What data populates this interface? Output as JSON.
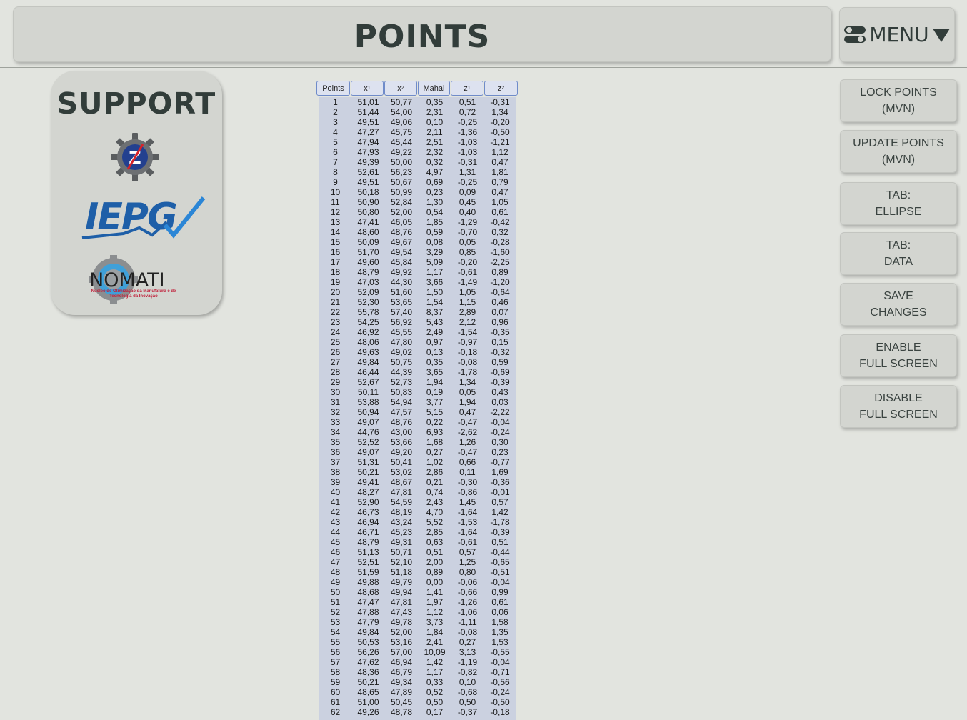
{
  "header": {
    "title": "POINTS",
    "menu_label": "MENU"
  },
  "support": {
    "title": "SUPPORT",
    "logos": [
      {
        "name": "gear-z-logo",
        "text": "Z"
      },
      {
        "name": "iepg-logo",
        "text": "IEPG"
      },
      {
        "name": "nomati-logo",
        "text": "NOMATI",
        "subtext": "Núcleo de Otimização da Manufatura e de Tecnologia da Inovação"
      }
    ]
  },
  "table": {
    "columns": [
      {
        "label": "Points",
        "sub": ""
      },
      {
        "label": "x",
        "sub": "1"
      },
      {
        "label": "x",
        "sub": "2"
      },
      {
        "label": "Mahal",
        "sub": ""
      },
      {
        "label": "z",
        "sub": "1"
      },
      {
        "label": "z",
        "sub": "2"
      }
    ],
    "rows": [
      [
        "1",
        "51,01",
        "50,77",
        "0,35",
        "0,51",
        "-0,31"
      ],
      [
        "2",
        "51,44",
        "54,00",
        "2,31",
        "0,72",
        "1,34"
      ],
      [
        "3",
        "49,51",
        "49,06",
        "0,10",
        "-0,25",
        "-0,20"
      ],
      [
        "4",
        "47,27",
        "45,75",
        "2,11",
        "-1,36",
        "-0,50"
      ],
      [
        "5",
        "47,94",
        "45,44",
        "2,51",
        "-1,03",
        "-1,21"
      ],
      [
        "6",
        "47,93",
        "49,22",
        "2,32",
        "-1,03",
        "1,12"
      ],
      [
        "7",
        "49,39",
        "50,00",
        "0,32",
        "-0,31",
        "0,47"
      ],
      [
        "8",
        "52,61",
        "56,23",
        "4,97",
        "1,31",
        "1,81"
      ],
      [
        "9",
        "49,51",
        "50,67",
        "0,69",
        "-0,25",
        "0,79"
      ],
      [
        "10",
        "50,18",
        "50,99",
        "0,23",
        "0,09",
        "0,47"
      ],
      [
        "11",
        "50,90",
        "52,84",
        "1,30",
        "0,45",
        "1,05"
      ],
      [
        "12",
        "50,80",
        "52,00",
        "0,54",
        "0,40",
        "0,61"
      ],
      [
        "13",
        "47,41",
        "46,05",
        "1,85",
        "-1,29",
        "-0,42"
      ],
      [
        "14",
        "48,60",
        "48,76",
        "0,59",
        "-0,70",
        "0,32"
      ],
      [
        "15",
        "50,09",
        "49,67",
        "0,08",
        "0,05",
        "-0,28"
      ],
      [
        "16",
        "51,70",
        "49,54",
        "3,29",
        "0,85",
        "-1,60"
      ],
      [
        "17",
        "49,60",
        "45,84",
        "5,09",
        "-0,20",
        "-2,25"
      ],
      [
        "18",
        "48,79",
        "49,92",
        "1,17",
        "-0,61",
        "0,89"
      ],
      [
        "19",
        "47,03",
        "44,30",
        "3,66",
        "-1,49",
        "-1,20"
      ],
      [
        "20",
        "52,09",
        "51,60",
        "1,50",
        "1,05",
        "-0,64"
      ],
      [
        "21",
        "52,30",
        "53,65",
        "1,54",
        "1,15",
        "0,46"
      ],
      [
        "22",
        "55,78",
        "57,40",
        "8,37",
        "2,89",
        "0,07"
      ],
      [
        "23",
        "54,25",
        "56,92",
        "5,43",
        "2,12",
        "0,96"
      ],
      [
        "24",
        "46,92",
        "45,55",
        "2,49",
        "-1,54",
        "-0,35"
      ],
      [
        "25",
        "48,06",
        "47,80",
        "0,97",
        "-0,97",
        "0,15"
      ],
      [
        "26",
        "49,63",
        "49,02",
        "0,13",
        "-0,18",
        "-0,32"
      ],
      [
        "27",
        "49,84",
        "50,75",
        "0,35",
        "-0,08",
        "0,59"
      ],
      [
        "28",
        "46,44",
        "44,39",
        "3,65",
        "-1,78",
        "-0,69"
      ],
      [
        "29",
        "52,67",
        "52,73",
        "1,94",
        "1,34",
        "-0,39"
      ],
      [
        "30",
        "50,11",
        "50,83",
        "0,19",
        "0,05",
        "0,43"
      ],
      [
        "31",
        "53,88",
        "54,94",
        "3,77",
        "1,94",
        "0,03"
      ],
      [
        "32",
        "50,94",
        "47,57",
        "5,15",
        "0,47",
        "-2,22"
      ],
      [
        "33",
        "49,07",
        "48,76",
        "0,22",
        "-0,47",
        "-0,04"
      ],
      [
        "34",
        "44,76",
        "43,00",
        "6,93",
        "-2,62",
        "-0,24"
      ],
      [
        "35",
        "52,52",
        "53,66",
        "1,68",
        "1,26",
        "0,30"
      ],
      [
        "36",
        "49,07",
        "49,20",
        "0,27",
        "-0,47",
        "0,23"
      ],
      [
        "37",
        "51,31",
        "50,41",
        "1,02",
        "0,66",
        "-0,77"
      ],
      [
        "38",
        "50,21",
        "53,02",
        "2,86",
        "0,11",
        "1,69"
      ],
      [
        "39",
        "49,41",
        "48,67",
        "0,21",
        "-0,30",
        "-0,36"
      ],
      [
        "40",
        "48,27",
        "47,81",
        "0,74",
        "-0,86",
        "-0,01"
      ],
      [
        "41",
        "52,90",
        "54,59",
        "2,43",
        "1,45",
        "0,57"
      ],
      [
        "42",
        "46,73",
        "48,19",
        "4,70",
        "-1,64",
        "1,42"
      ],
      [
        "43",
        "46,94",
        "43,24",
        "5,52",
        "-1,53",
        "-1,78"
      ],
      [
        "44",
        "46,71",
        "45,23",
        "2,85",
        "-1,64",
        "-0,39"
      ],
      [
        "45",
        "48,79",
        "49,31",
        "0,63",
        "-0,61",
        "0,51"
      ],
      [
        "46",
        "51,13",
        "50,71",
        "0,51",
        "0,57",
        "-0,44"
      ],
      [
        "47",
        "52,51",
        "52,10",
        "2,00",
        "1,25",
        "-0,65"
      ],
      [
        "48",
        "51,59",
        "51,18",
        "0,89",
        "0,80",
        "-0,51"
      ],
      [
        "49",
        "49,88",
        "49,79",
        "0,00",
        "-0,06",
        "-0,04"
      ],
      [
        "50",
        "48,68",
        "49,94",
        "1,41",
        "-0,66",
        "0,99"
      ],
      [
        "51",
        "47,47",
        "47,81",
        "1,97",
        "-1,26",
        "0,61"
      ],
      [
        "52",
        "47,88",
        "47,43",
        "1,12",
        "-1,06",
        "0,06"
      ],
      [
        "53",
        "47,79",
        "49,78",
        "3,73",
        "-1,11",
        "1,58"
      ],
      [
        "54",
        "49,84",
        "52,00",
        "1,84",
        "-0,08",
        "1,35"
      ],
      [
        "55",
        "50,53",
        "53,16",
        "2,41",
        "0,27",
        "1,53"
      ],
      [
        "56",
        "56,26",
        "57,00",
        "10,09",
        "3,13",
        "-0,55"
      ],
      [
        "57",
        "47,62",
        "46,94",
        "1,42",
        "-1,19",
        "-0,04"
      ],
      [
        "58",
        "48,36",
        "46,79",
        "1,17",
        "-0,82",
        "-0,71"
      ],
      [
        "59",
        "50,21",
        "49,34",
        "0,33",
        "0,10",
        "-0,56"
      ],
      [
        "60",
        "48,65",
        "47,89",
        "0,52",
        "-0,68",
        "-0,24"
      ],
      [
        "61",
        "51,00",
        "50,45",
        "0,50",
        "0,50",
        "-0,50"
      ],
      [
        "62",
        "49,26",
        "48,78",
        "0,17",
        "-0,37",
        "-0,18"
      ]
    ]
  },
  "buttons": [
    {
      "line1": "LOCK POINTS",
      "line2": "(MVN)"
    },
    {
      "line1": "UPDATE POINTS",
      "line2": "(MVN)"
    },
    {
      "line1": "TAB:",
      "line2": "ELLIPSE"
    },
    {
      "line1": "TAB:",
      "line2": "DATA"
    },
    {
      "line1": "SAVE",
      "line2": "CHANGES"
    },
    {
      "line1": "ENABLE",
      "line2": "FULL SCREEN"
    },
    {
      "line1": "DISABLE",
      "line2": "FULL SCREEN"
    }
  ],
  "colors": {
    "background": "#e2e4df",
    "panel": "#d3d5d0",
    "table_header_border": "#6f8bc9",
    "table_body": "#cbd1e0",
    "iepg_blue": "#1e5fa8",
    "iepg_check": "#2b86d6",
    "nomati_red": "#c0203a"
  }
}
